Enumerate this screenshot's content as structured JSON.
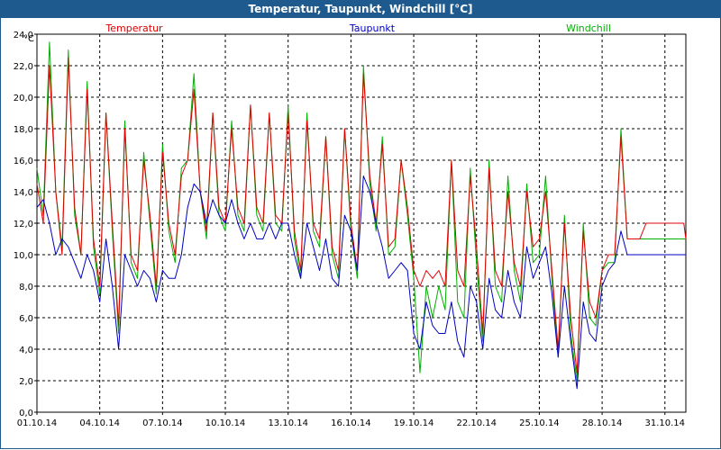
{
  "window": {
    "title": "Temperatur, Taupunkt, Windchill [°C]"
  },
  "chart_data": {
    "type": "line",
    "title": "Temperatur, Taupunkt, Windchill [°C]",
    "unit_label": "°C",
    "xlabel": "",
    "ylabel": "°C",
    "ylim": [
      0,
      24
    ],
    "yticks": [
      "0,0",
      "2,0",
      "4,0",
      "6,0",
      "8,0",
      "10,0",
      "12,0",
      "14,0",
      "16,0",
      "18,0",
      "20,0",
      "22,0",
      "24,0"
    ],
    "xticks": [
      "01.10.14",
      "04.10.14",
      "07.10.14",
      "10.10.14",
      "13.10.14",
      "16.10.14",
      "19.10.14",
      "22.10.14",
      "25.10.14",
      "28.10.14",
      "31.10.14"
    ],
    "x_start_day": 1,
    "x_end_day": 32,
    "grid": true,
    "legend_position": "top",
    "x": [
      1.0,
      1.3,
      1.6,
      1.9,
      2.2,
      2.5,
      2.8,
      3.1,
      3.4,
      3.7,
      4.0,
      4.3,
      4.6,
      4.9,
      5.2,
      5.5,
      5.8,
      6.1,
      6.4,
      6.7,
      7.0,
      7.3,
      7.6,
      7.9,
      8.2,
      8.5,
      8.8,
      9.1,
      9.4,
      9.7,
      10.0,
      10.3,
      10.6,
      10.9,
      11.2,
      11.5,
      11.8,
      12.1,
      12.4,
      12.7,
      13.0,
      13.3,
      13.6,
      13.9,
      14.2,
      14.5,
      14.8,
      15.1,
      15.4,
      15.7,
      16.0,
      16.3,
      16.6,
      16.9,
      17.2,
      17.5,
      17.8,
      18.1,
      18.4,
      18.7,
      19.0,
      19.3,
      19.6,
      19.9,
      20.2,
      20.5,
      20.8,
      21.1,
      21.4,
      21.7,
      22.0,
      22.3,
      22.6,
      22.9,
      23.2,
      23.5,
      23.8,
      24.1,
      24.4,
      24.7,
      25.0,
      25.3,
      25.6,
      25.9,
      26.2,
      26.5,
      26.8,
      27.1,
      27.4,
      27.7,
      28.0,
      28.3,
      28.6,
      28.9,
      29.2,
      29.5,
      29.8,
      30.1,
      30.4,
      30.7,
      31.0,
      31.3,
      31.6,
      31.9,
      32.0
    ],
    "series": [
      {
        "name": "Temperatur",
        "color": "#e00000",
        "values": [
          14.5,
          12.0,
          22.0,
          14.0,
          10.0,
          22.5,
          13.0,
          10.0,
          20.5,
          11.0,
          8.0,
          19.0,
          12.0,
          5.5,
          18.0,
          10.0,
          9.0,
          16.0,
          12.5,
          8.0,
          16.5,
          12.0,
          10.0,
          15.0,
          16.0,
          20.5,
          14.0,
          11.5,
          19.0,
          13.0,
          12.0,
          18.0,
          13.0,
          12.0,
          19.5,
          13.0,
          12.0,
          19.0,
          12.5,
          12.0,
          19.0,
          11.5,
          9.0,
          18.5,
          12.0,
          11.0,
          17.5,
          10.5,
          9.0,
          18.0,
          12.0,
          9.0,
          21.5,
          15.0,
          12.0,
          17.0,
          10.5,
          11.0,
          16.0,
          13.0,
          9.0,
          8.0,
          9.0,
          8.5,
          9.0,
          8.0,
          16.0,
          9.0,
          8.0,
          15.0,
          10.5,
          5.0,
          15.5,
          9.0,
          8.0,
          14.0,
          9.5,
          8.0,
          14.0,
          10.5,
          11.0,
          14.0,
          9.0,
          4.0,
          12.0,
          6.0,
          2.5,
          11.5,
          7.0,
          6.0,
          9.0,
          10.0,
          10.0,
          17.5,
          11.0,
          11.0,
          11.0,
          12.0,
          12.0,
          12.0,
          12.0,
          12.0,
          12.0,
          12.0,
          11.0
        ]
      },
      {
        "name": "Taupunkt",
        "color": "#0000c0",
        "values": [
          13.0,
          13.5,
          12.0,
          10.0,
          11.0,
          10.5,
          9.5,
          8.5,
          10.0,
          9.0,
          7.0,
          11.0,
          8.0,
          4.0,
          10.0,
          9.0,
          8.0,
          9.0,
          8.5,
          7.0,
          9.0,
          8.5,
          8.5,
          10.0,
          13.0,
          14.5,
          14.0,
          12.0,
          13.5,
          12.5,
          12.0,
          13.5,
          12.0,
          11.0,
          12.0,
          11.0,
          11.0,
          12.0,
          11.0,
          12.0,
          12.0,
          10.0,
          8.5,
          12.0,
          10.5,
          9.0,
          11.0,
          8.5,
          8.0,
          12.5,
          11.5,
          9.0,
          15.0,
          14.0,
          12.0,
          10.5,
          8.5,
          9.0,
          9.5,
          9.0,
          5.0,
          4.0,
          7.0,
          5.5,
          5.0,
          5.0,
          7.0,
          4.5,
          3.5,
          8.0,
          7.0,
          4.0,
          8.5,
          6.5,
          6.0,
          9.0,
          7.0,
          6.0,
          10.5,
          8.5,
          9.5,
          10.5,
          7.5,
          3.5,
          8.0,
          4.5,
          1.5,
          7.0,
          5.0,
          4.5,
          8.0,
          9.0,
          9.5,
          11.5,
          10.0,
          10.0,
          10.0,
          10.0,
          10.0,
          10.0,
          10.0,
          10.0,
          10.0,
          10.0,
          10.0
        ]
      },
      {
        "name": "Windchill",
        "color": "#00b000",
        "values": [
          15.5,
          12.5,
          23.5,
          14.0,
          10.5,
          23.0,
          12.5,
          10.0,
          21.0,
          10.5,
          7.5,
          19.0,
          11.5,
          5.0,
          18.5,
          9.5,
          8.5,
          16.5,
          12.0,
          7.5,
          17.0,
          11.5,
          9.5,
          15.5,
          16.0,
          21.5,
          14.0,
          11.0,
          19.0,
          12.5,
          11.5,
          18.5,
          12.5,
          11.5,
          19.5,
          12.5,
          11.5,
          19.0,
          12.0,
          11.5,
          19.5,
          11.0,
          8.5,
          19.0,
          11.5,
          10.5,
          17.5,
          10.0,
          8.5,
          18.0,
          11.5,
          8.5,
          22.0,
          14.5,
          11.5,
          17.5,
          10.0,
          10.5,
          16.0,
          12.5,
          8.5,
          2.5,
          8.0,
          6.0,
          8.0,
          6.5,
          16.0,
          7.0,
          6.0,
          15.5,
          9.5,
          4.5,
          16.0,
          8.0,
          7.0,
          15.0,
          9.0,
          7.0,
          14.5,
          9.5,
          10.0,
          15.0,
          8.5,
          3.5,
          12.5,
          5.0,
          2.0,
          12.0,
          6.0,
          5.5,
          9.0,
          9.5,
          9.5,
          18.0,
          11.0,
          11.0,
          11.0,
          11.0,
          11.0,
          11.0,
          11.0,
          11.0,
          11.0,
          11.0,
          11.0
        ]
      }
    ]
  }
}
